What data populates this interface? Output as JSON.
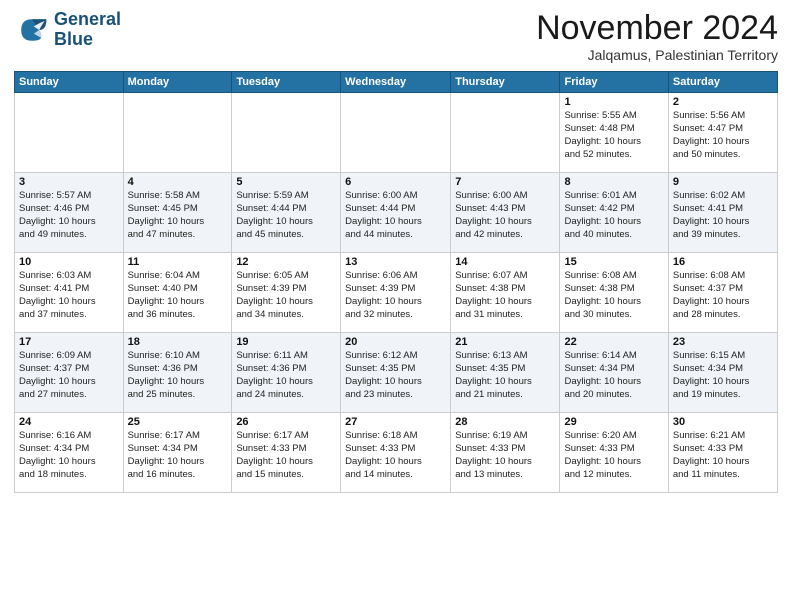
{
  "logo": {
    "line1": "General",
    "line2": "Blue"
  },
  "title": "November 2024",
  "location": "Jalqamus, Palestinian Territory",
  "header_days": [
    "Sunday",
    "Monday",
    "Tuesday",
    "Wednesday",
    "Thursday",
    "Friday",
    "Saturday"
  ],
  "weeks": [
    [
      {
        "day": "",
        "info": ""
      },
      {
        "day": "",
        "info": ""
      },
      {
        "day": "",
        "info": ""
      },
      {
        "day": "",
        "info": ""
      },
      {
        "day": "",
        "info": ""
      },
      {
        "day": "1",
        "info": "Sunrise: 5:55 AM\nSunset: 4:48 PM\nDaylight: 10 hours\nand 52 minutes."
      },
      {
        "day": "2",
        "info": "Sunrise: 5:56 AM\nSunset: 4:47 PM\nDaylight: 10 hours\nand 50 minutes."
      }
    ],
    [
      {
        "day": "3",
        "info": "Sunrise: 5:57 AM\nSunset: 4:46 PM\nDaylight: 10 hours\nand 49 minutes."
      },
      {
        "day": "4",
        "info": "Sunrise: 5:58 AM\nSunset: 4:45 PM\nDaylight: 10 hours\nand 47 minutes."
      },
      {
        "day": "5",
        "info": "Sunrise: 5:59 AM\nSunset: 4:44 PM\nDaylight: 10 hours\nand 45 minutes."
      },
      {
        "day": "6",
        "info": "Sunrise: 6:00 AM\nSunset: 4:44 PM\nDaylight: 10 hours\nand 44 minutes."
      },
      {
        "day": "7",
        "info": "Sunrise: 6:00 AM\nSunset: 4:43 PM\nDaylight: 10 hours\nand 42 minutes."
      },
      {
        "day": "8",
        "info": "Sunrise: 6:01 AM\nSunset: 4:42 PM\nDaylight: 10 hours\nand 40 minutes."
      },
      {
        "day": "9",
        "info": "Sunrise: 6:02 AM\nSunset: 4:41 PM\nDaylight: 10 hours\nand 39 minutes."
      }
    ],
    [
      {
        "day": "10",
        "info": "Sunrise: 6:03 AM\nSunset: 4:41 PM\nDaylight: 10 hours\nand 37 minutes."
      },
      {
        "day": "11",
        "info": "Sunrise: 6:04 AM\nSunset: 4:40 PM\nDaylight: 10 hours\nand 36 minutes."
      },
      {
        "day": "12",
        "info": "Sunrise: 6:05 AM\nSunset: 4:39 PM\nDaylight: 10 hours\nand 34 minutes."
      },
      {
        "day": "13",
        "info": "Sunrise: 6:06 AM\nSunset: 4:39 PM\nDaylight: 10 hours\nand 32 minutes."
      },
      {
        "day": "14",
        "info": "Sunrise: 6:07 AM\nSunset: 4:38 PM\nDaylight: 10 hours\nand 31 minutes."
      },
      {
        "day": "15",
        "info": "Sunrise: 6:08 AM\nSunset: 4:38 PM\nDaylight: 10 hours\nand 30 minutes."
      },
      {
        "day": "16",
        "info": "Sunrise: 6:08 AM\nSunset: 4:37 PM\nDaylight: 10 hours\nand 28 minutes."
      }
    ],
    [
      {
        "day": "17",
        "info": "Sunrise: 6:09 AM\nSunset: 4:37 PM\nDaylight: 10 hours\nand 27 minutes."
      },
      {
        "day": "18",
        "info": "Sunrise: 6:10 AM\nSunset: 4:36 PM\nDaylight: 10 hours\nand 25 minutes."
      },
      {
        "day": "19",
        "info": "Sunrise: 6:11 AM\nSunset: 4:36 PM\nDaylight: 10 hours\nand 24 minutes."
      },
      {
        "day": "20",
        "info": "Sunrise: 6:12 AM\nSunset: 4:35 PM\nDaylight: 10 hours\nand 23 minutes."
      },
      {
        "day": "21",
        "info": "Sunrise: 6:13 AM\nSunset: 4:35 PM\nDaylight: 10 hours\nand 21 minutes."
      },
      {
        "day": "22",
        "info": "Sunrise: 6:14 AM\nSunset: 4:34 PM\nDaylight: 10 hours\nand 20 minutes."
      },
      {
        "day": "23",
        "info": "Sunrise: 6:15 AM\nSunset: 4:34 PM\nDaylight: 10 hours\nand 19 minutes."
      }
    ],
    [
      {
        "day": "24",
        "info": "Sunrise: 6:16 AM\nSunset: 4:34 PM\nDaylight: 10 hours\nand 18 minutes."
      },
      {
        "day": "25",
        "info": "Sunrise: 6:17 AM\nSunset: 4:34 PM\nDaylight: 10 hours\nand 16 minutes."
      },
      {
        "day": "26",
        "info": "Sunrise: 6:17 AM\nSunset: 4:33 PM\nDaylight: 10 hours\nand 15 minutes."
      },
      {
        "day": "27",
        "info": "Sunrise: 6:18 AM\nSunset: 4:33 PM\nDaylight: 10 hours\nand 14 minutes."
      },
      {
        "day": "28",
        "info": "Sunrise: 6:19 AM\nSunset: 4:33 PM\nDaylight: 10 hours\nand 13 minutes."
      },
      {
        "day": "29",
        "info": "Sunrise: 6:20 AM\nSunset: 4:33 PM\nDaylight: 10 hours\nand 12 minutes."
      },
      {
        "day": "30",
        "info": "Sunrise: 6:21 AM\nSunset: 4:33 PM\nDaylight: 10 hours\nand 11 minutes."
      }
    ]
  ]
}
